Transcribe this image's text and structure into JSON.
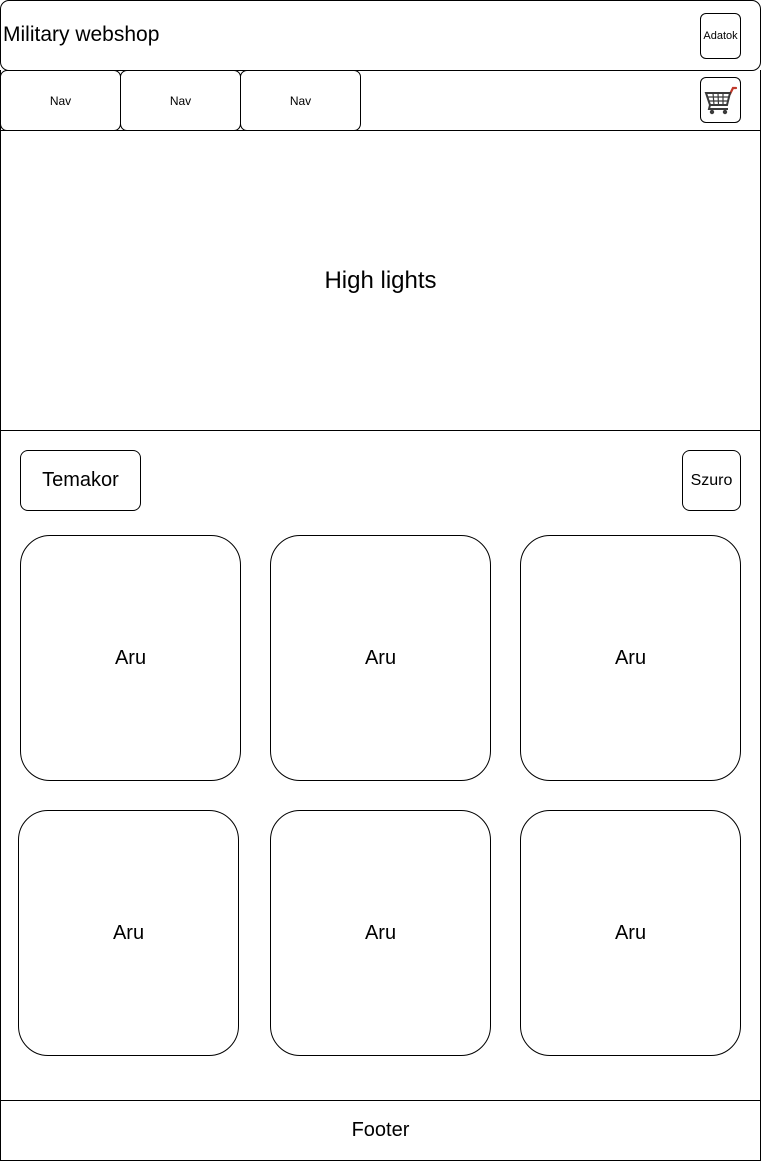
{
  "header": {
    "title": "Military webshop",
    "account_button": "Adatok"
  },
  "nav": {
    "items": [
      {
        "label": "Nav"
      },
      {
        "label": "Nav"
      },
      {
        "label": "Nav"
      }
    ],
    "cart_icon": "shopping-cart-icon"
  },
  "highlights": {
    "label": "High lights"
  },
  "toolbar": {
    "topic_button": "Temakor",
    "filter_button": "Szuro"
  },
  "products": [
    {
      "label": "Aru"
    },
    {
      "label": "Aru"
    },
    {
      "label": "Aru"
    },
    {
      "label": "Aru"
    },
    {
      "label": "Aru"
    },
    {
      "label": "Aru"
    }
  ],
  "footer": {
    "label": "Footer"
  },
  "colors": {
    "stroke": "#000000",
    "background": "#ffffff",
    "cart_basket": "#3a3a3a",
    "cart_handle": "#c0392b"
  }
}
